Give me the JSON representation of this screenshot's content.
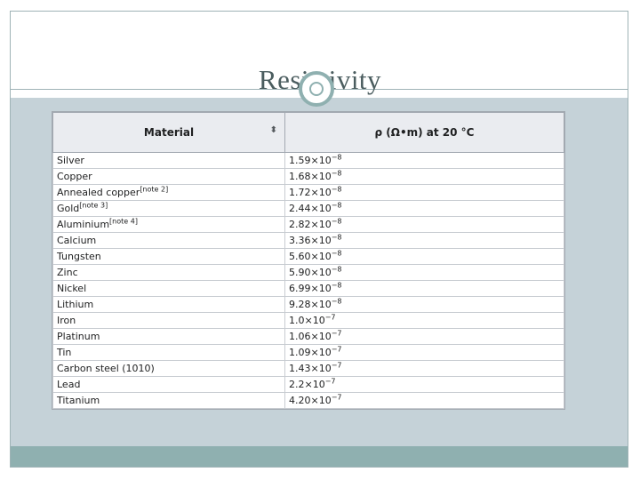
{
  "slide": {
    "title": "Resistivity"
  },
  "table": {
    "headers": {
      "material": "Material",
      "resistivity": "ρ (Ω•m) at 20 °C",
      "sort_icon": "sort-arrows-icon"
    },
    "rows": [
      {
        "material": "Silver",
        "note": "",
        "base": "1.59×10",
        "exp": "−8"
      },
      {
        "material": "Copper",
        "note": "",
        "base": "1.68×10",
        "exp": "−8"
      },
      {
        "material": "Annealed copper",
        "note": "[note 2]",
        "base": "1.72×10",
        "exp": "−8"
      },
      {
        "material": "Gold",
        "note": "[note 3]",
        "base": "2.44×10",
        "exp": "−8"
      },
      {
        "material": "Aluminium",
        "note": "[note 4]",
        "base": "2.82×10",
        "exp": "−8"
      },
      {
        "material": "Calcium",
        "note": "",
        "base": "3.36×10",
        "exp": "−8"
      },
      {
        "material": "Tungsten",
        "note": "",
        "base": "5.60×10",
        "exp": "−8"
      },
      {
        "material": "Zinc",
        "note": "",
        "base": "5.90×10",
        "exp": "−8"
      },
      {
        "material": "Nickel",
        "note": "",
        "base": "6.99×10",
        "exp": "−8"
      },
      {
        "material": "Lithium",
        "note": "",
        "base": "9.28×10",
        "exp": "−8"
      },
      {
        "material": "Iron",
        "note": "",
        "base": "1.0×10",
        "exp": "−7"
      },
      {
        "material": "Platinum",
        "note": "",
        "base": "1.06×10",
        "exp": "−7"
      },
      {
        "material": "Tin",
        "note": "",
        "base": "1.09×10",
        "exp": "−7"
      },
      {
        "material": "Carbon steel (1010)",
        "note": "",
        "base": "1.43×10",
        "exp": "−7"
      },
      {
        "material": "Lead",
        "note": "",
        "base": "2.2×10",
        "exp": "−7"
      },
      {
        "material": "Titanium",
        "note": "",
        "base": "4.20×10",
        "exp": "−7"
      }
    ]
  },
  "colors": {
    "content_band": "#c5d2d8",
    "footer_band": "#8fb0b0",
    "title_text": "#4b5d5f"
  }
}
